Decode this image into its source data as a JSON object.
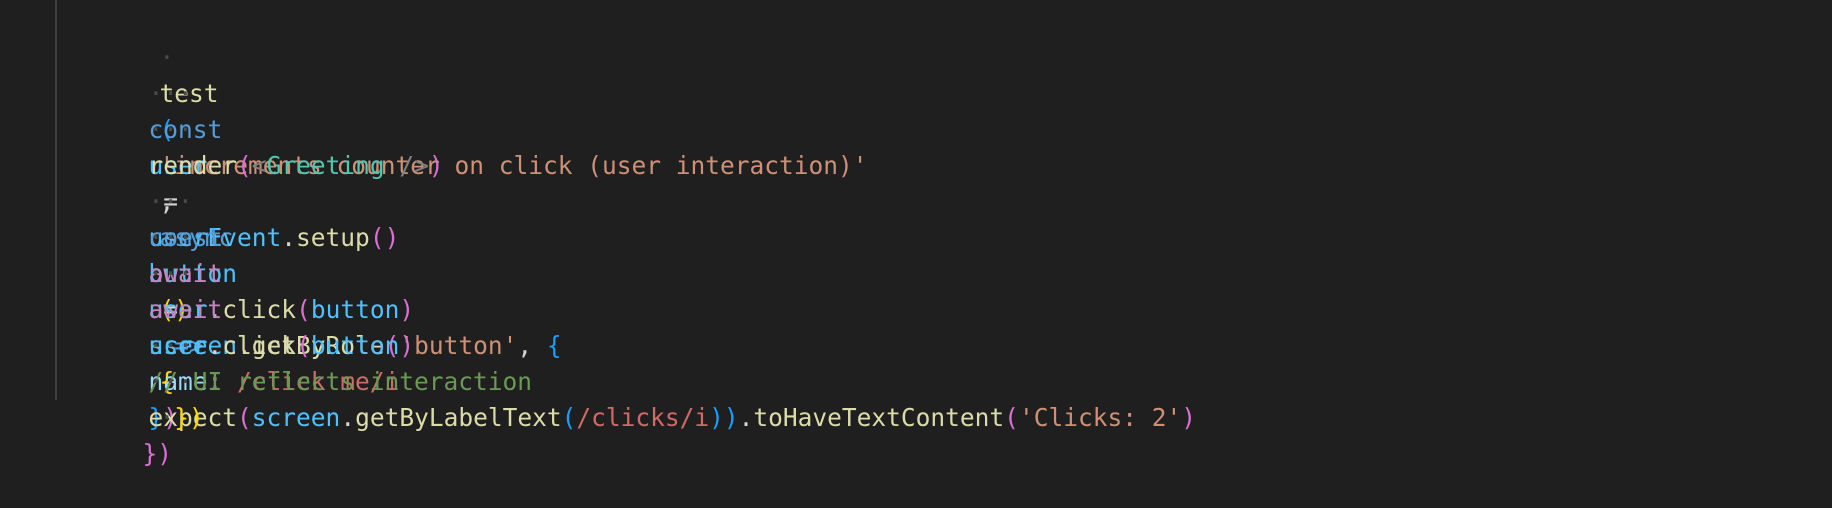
{
  "editor": {
    "language": "javascript",
    "theme_colors": {
      "background": "#1f1f1f",
      "function": "#dcdcaa",
      "string": "#ce9178",
      "keyword": "#569cd6",
      "control": "#c586c0",
      "variable": "#9cdcfe",
      "component": "#4ec9b0",
      "comment": "#6a9955",
      "regex": "#d16969",
      "bracket_1": "#ffd700",
      "bracket_2": "#da70d6",
      "bracket_3": "#179fff"
    },
    "lines": [
      "  test('increments counter on click (user interaction)', async () => {",
      "    const user = userEvent.setup()",
      "    render(<Greeting />)",
      "",
      "    const button = screen.getByRole('button', { name: /click me/i })",
      "    await user.click(button)",
      "    await user.click(button)",
      "",
      "    // UI reflects interaction",
      "    expect(screen.getByLabelText(/clicks/i)).toHaveTextContent('Clicks: 2')",
      "  })",
      "})"
    ],
    "tokens": {
      "l1": {
        "ind": "·",
        "fn": "test",
        "p1": "(",
        "str": "'increments counter on click (user interaction)'",
        "comma": ", ",
        "kw": "async",
        "sp": " ",
        "p2": "()",
        "arrow": " => ",
        "brace": "{"
      },
      "l2": {
        "ind": "···",
        "kw": "const",
        "var": "user",
        "eq": " = ",
        "obj": "userEvent",
        "dot": ".",
        "fn": "setup",
        "parens": "()"
      },
      "l3": {
        "ind": "···",
        "fn": "render",
        "p1": "(",
        "lt": "<",
        "comp": "Greeting",
        "close": " />",
        "p2": ")"
      },
      "l5": {
        "ind": "···",
        "kw": "const",
        "var": "button",
        "eq": " = ",
        "obj": "screen",
        "dot": ".",
        "fn": "getByRole",
        "p1": "(",
        "str": "'button'",
        "comma": ", ",
        "ob": "{",
        "prop": "name",
        "colon": ": ",
        "re": "/click me/i",
        "cb": "}",
        "p2": ")"
      },
      "l6": {
        "ind": "···",
        "ctl": "await",
        "obj": "user",
        "dot": ".",
        "fn": "click",
        "p1": "(",
        "arg": "button",
        "p2": ")"
      },
      "l7": {
        "ind": "···",
        "ctl": "await",
        "obj": "user",
        "dot": ".",
        "fn": "click",
        "p1": "(",
        "arg": "button",
        "p2": ")"
      },
      "l9": {
        "ind": "···",
        "cmt": "// UI reflects interaction"
      },
      "l10": {
        "ind": "···",
        "fn": "expect",
        "p1": "(",
        "obj": "screen",
        "dot": ".",
        "fn2": "getByLabelText",
        "p2": "(",
        "re": "/clicks/i",
        "p3": "))",
        "dot2": ".",
        "fn3": "toHaveTextContent",
        "p4": "(",
        "str": "'Clicks: 2'",
        "p5": ")"
      },
      "l11": {
        "ind": "·",
        "close": "})"
      },
      "l12": {
        "close": "})"
      }
    }
  }
}
